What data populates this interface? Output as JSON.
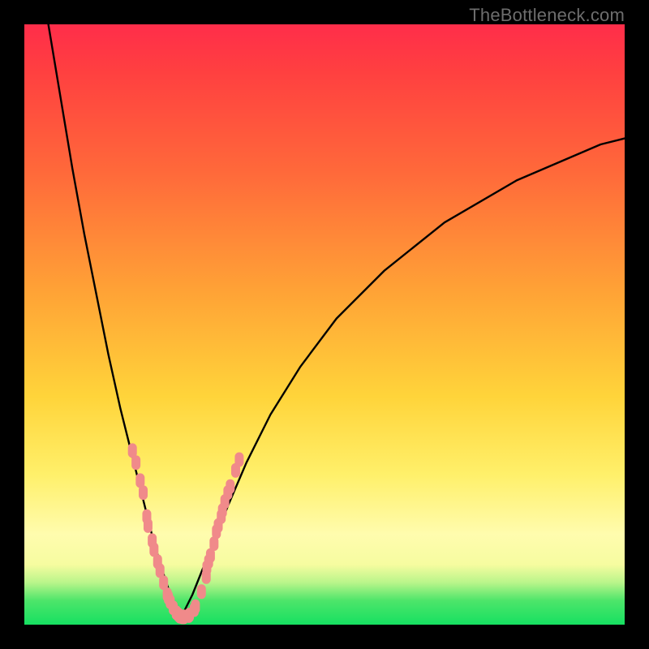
{
  "watermark": "TheBottleneck.com",
  "chart_data": {
    "type": "line",
    "title": "",
    "xlabel": "",
    "ylabel": "",
    "xlim": [
      0,
      100
    ],
    "ylim": [
      0,
      100
    ],
    "background_gradient": {
      "orientation": "vertical",
      "stops": [
        {
          "pos": 0.0,
          "color": "#ff2d4a"
        },
        {
          "pos": 0.25,
          "color": "#ff6a3a"
        },
        {
          "pos": 0.45,
          "color": "#ffa436"
        },
        {
          "pos": 0.62,
          "color": "#ffd43a"
        },
        {
          "pos": 0.85,
          "color": "#fffcae"
        },
        {
          "pos": 0.96,
          "color": "#4de56a"
        },
        {
          "pos": 1.0,
          "color": "#16e061"
        }
      ]
    },
    "series": [
      {
        "name": "left-curve",
        "x": [
          4,
          6,
          8,
          10,
          12,
          14,
          16,
          18,
          20,
          21.5,
          23,
          24.5,
          26
        ],
        "y": [
          100,
          88,
          76,
          65,
          55,
          45,
          36,
          28,
          20,
          14,
          9,
          4.5,
          1
        ]
      },
      {
        "name": "right-curve",
        "x": [
          26,
          28,
          30,
          32,
          34,
          37,
          41,
          46,
          52,
          60,
          70,
          82,
          96,
          100
        ],
        "y": [
          1,
          5,
          10,
          15,
          20,
          27,
          35,
          43,
          51,
          59,
          67,
          74,
          80,
          81
        ]
      }
    ],
    "scatter_overlay": {
      "name": "pink-markers",
      "color": "#f08a8a",
      "points": [
        {
          "x": 18.0,
          "y": 29
        },
        {
          "x": 18.6,
          "y": 27
        },
        {
          "x": 19.3,
          "y": 24
        },
        {
          "x": 19.8,
          "y": 22
        },
        {
          "x": 20.4,
          "y": 18
        },
        {
          "x": 20.6,
          "y": 16.5
        },
        {
          "x": 21.3,
          "y": 14
        },
        {
          "x": 21.6,
          "y": 12.5
        },
        {
          "x": 22.2,
          "y": 10.5
        },
        {
          "x": 22.6,
          "y": 9
        },
        {
          "x": 23.2,
          "y": 7
        },
        {
          "x": 23.8,
          "y": 5
        },
        {
          "x": 24.0,
          "y": 4.5
        },
        {
          "x": 24.3,
          "y": 3.8
        },
        {
          "x": 24.8,
          "y": 2.8
        },
        {
          "x": 25.3,
          "y": 2.0
        },
        {
          "x": 25.6,
          "y": 1.7
        },
        {
          "x": 25.8,
          "y": 1.5
        },
        {
          "x": 25.9,
          "y": 1.4
        },
        {
          "x": 26.3,
          "y": 1.3
        },
        {
          "x": 26.6,
          "y": 1.3
        },
        {
          "x": 27.4,
          "y": 1.5
        },
        {
          "x": 27.5,
          "y": 1.6
        },
        {
          "x": 28.3,
          "y": 2.5
        },
        {
          "x": 28.5,
          "y": 3.0
        },
        {
          "x": 29.5,
          "y": 5.5
        },
        {
          "x": 30.3,
          "y": 8.0
        },
        {
          "x": 30.4,
          "y": 9.5
        },
        {
          "x": 30.7,
          "y": 10.5
        },
        {
          "x": 31.0,
          "y": 11.5
        },
        {
          "x": 31.6,
          "y": 13.5
        },
        {
          "x": 32.0,
          "y": 15.5
        },
        {
          "x": 32.3,
          "y": 16.5
        },
        {
          "x": 32.8,
          "y": 18.0
        },
        {
          "x": 33.0,
          "y": 19.0
        },
        {
          "x": 33.4,
          "y": 20.5
        },
        {
          "x": 33.9,
          "y": 22.0
        },
        {
          "x": 34.3,
          "y": 23.0
        },
        {
          "x": 35.2,
          "y": 25.7
        },
        {
          "x": 35.8,
          "y": 27.5
        }
      ]
    }
  }
}
